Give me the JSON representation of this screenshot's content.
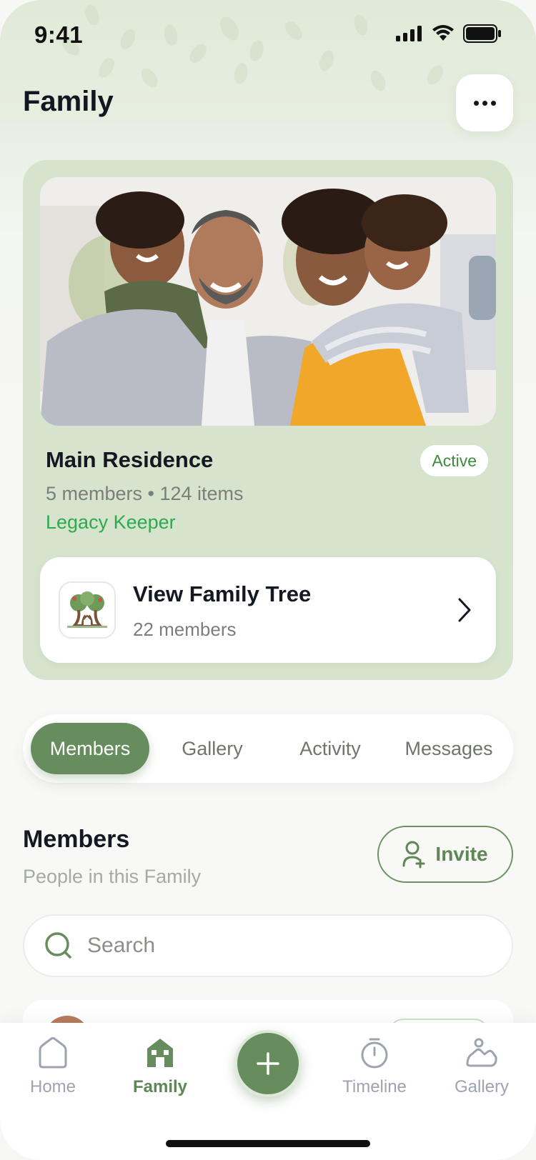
{
  "status_bar": {
    "time": "9:41"
  },
  "header": {
    "title": "Family"
  },
  "residence": {
    "name": "Main Residence",
    "meta": "5 members • 124 items",
    "role": "Legacy Keeper",
    "status": "Active",
    "family_tree": {
      "title": "View Family Tree",
      "subtitle": "22 members"
    }
  },
  "tabs": [
    {
      "label": "Members",
      "active": true
    },
    {
      "label": "Gallery",
      "active": false
    },
    {
      "label": "Activity",
      "active": false
    },
    {
      "label": "Messages",
      "active": false
    }
  ],
  "members_section": {
    "title": "Members",
    "subtitle": "People in this Family",
    "invite_label": "Invite",
    "search_placeholder": "Search"
  },
  "bottom_nav": [
    {
      "label": "Home",
      "icon": "home-icon",
      "active": false
    },
    {
      "label": "Family",
      "icon": "family-house-icon",
      "active": true
    },
    {
      "label": "",
      "icon": "plus-icon",
      "active": false
    },
    {
      "label": "Timeline",
      "icon": "timer-icon",
      "active": false
    },
    {
      "label": "Gallery",
      "icon": "mountain-image-icon",
      "active": false
    }
  ],
  "colors": {
    "accent": "#678d5f",
    "accent_text": "#5e8656",
    "role_green": "#2eaa4e",
    "card_bg": "#d6e3cd"
  }
}
